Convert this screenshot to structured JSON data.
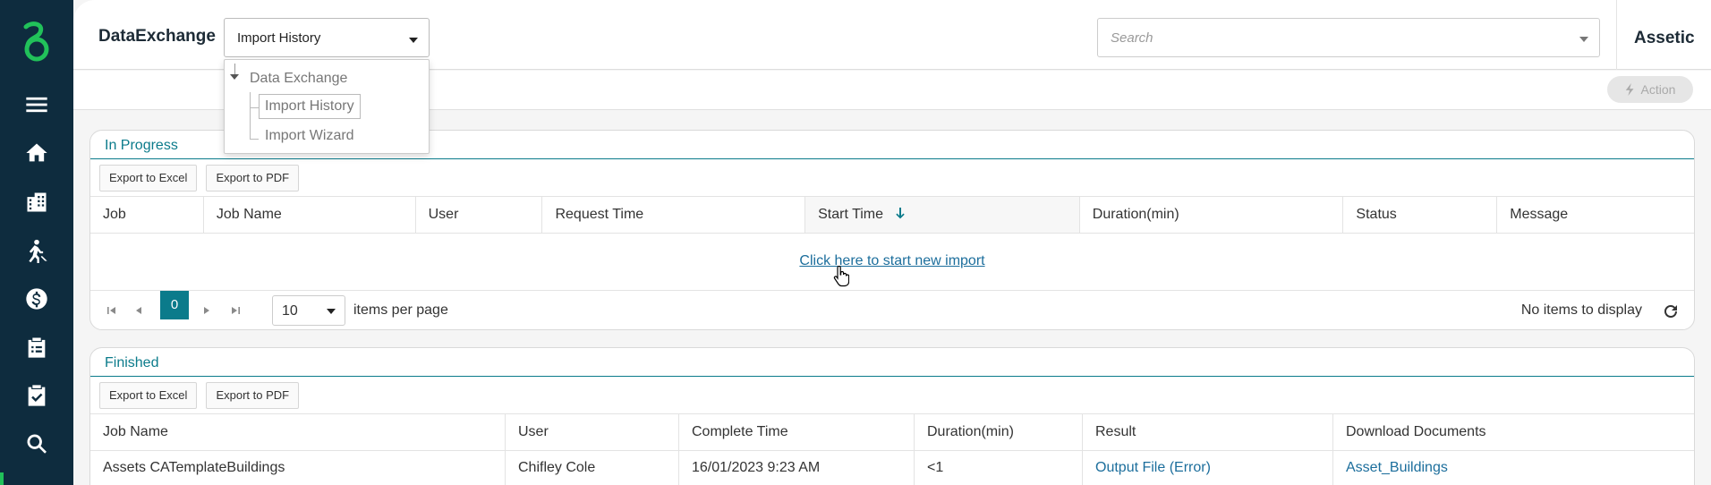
{
  "app": {
    "brand": "DataExchange",
    "account": "Assetic"
  },
  "nav": {
    "selected": "Import History",
    "tree": {
      "root": "Data Exchange",
      "items": [
        "Import History",
        "Import Wizard"
      ]
    }
  },
  "search": {
    "placeholder": "Search"
  },
  "subbar": {
    "action_label": "Action"
  },
  "sidebar": {
    "icons": [
      "app-logo-icon",
      "menu-icon",
      "home-icon",
      "buildings-icon",
      "worker-icon",
      "finance-icon",
      "clipboard-icon",
      "tasks-icon",
      "search-icon"
    ]
  },
  "in_progress": {
    "title": "In Progress",
    "export_excel": "Export to Excel",
    "export_pdf": "Export to PDF",
    "columns": [
      "Job",
      "Job Name",
      "User",
      "Request Time",
      "Start Time",
      "Duration(min)",
      "Status",
      "Message"
    ],
    "empty_link": "Click here to start new import",
    "pager": {
      "current_page": "0",
      "page_size": "10",
      "items_per_page": "items per page",
      "info": "No items to display"
    }
  },
  "finished": {
    "title": "Finished",
    "export_excel": "Export to Excel",
    "export_pdf": "Export to PDF",
    "columns": [
      "Job Name",
      "User",
      "Complete Time",
      "Duration(min)",
      "Result",
      "Download Documents"
    ],
    "rows": [
      {
        "job_name": "Assets CATemplateBuildings",
        "user": "Chifley Cole",
        "complete_time": "16/01/2023 9:23 AM",
        "duration": "<1",
        "result": "Output File (Error)",
        "download": "Asset_Buildings"
      }
    ]
  },
  "colors": {
    "sidebar_bg": "#0e2c3e",
    "accent_teal": "#0b7b8b",
    "link_blue": "#1c6e9c",
    "logo_green": "#21c15a"
  }
}
